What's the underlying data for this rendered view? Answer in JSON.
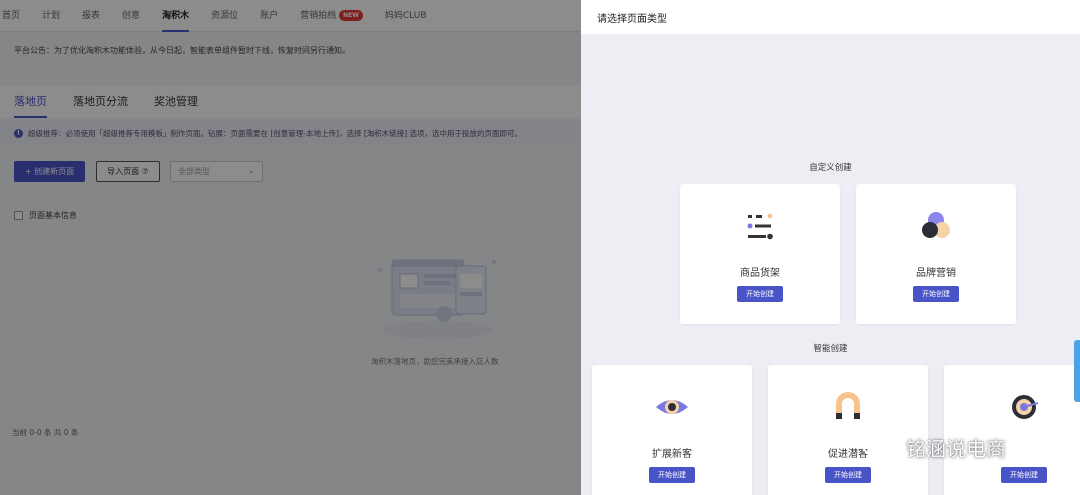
{
  "topnav": {
    "items": [
      "首页",
      "计划",
      "报表",
      "创意",
      "淘积木",
      "资源位",
      "账户",
      "营销拍档",
      "妈妈CLUB"
    ],
    "active_index": 4,
    "new_badge": "NEW"
  },
  "announcement": "平台公告：为了优化淘积木功能体验，从今日起，智能表单组件暂时下线，恢复时间另行通知。",
  "subtabs": {
    "items": [
      "落地页",
      "落地页分流",
      "奖池管理"
    ],
    "active_index": 0
  },
  "tip": "超级推荐：必须使用「超级推荐专用模板」制作页面。钻展：页面需要在 [创意管理-本地上传]，选择 [淘积木链接] 选项，选中用于投放的页面即可。",
  "toolbar": {
    "create_label": "+ 创建新页面",
    "import_label": "导入页面 ⑦",
    "filter_value": "全部类型"
  },
  "table": {
    "header_checkbox_label": "页面基本信息"
  },
  "empty_text": "淘积木落地页，助您完美承接入店人数",
  "pager_text": "当前 0-0 条 共 0 条",
  "drawer": {
    "title": "请选择页面类型",
    "custom_section": "自定义创建",
    "smart_section": "智能创建",
    "custom_cards": [
      {
        "label": "商品货架",
        "button": "开始创建",
        "icon": "shelf-icon"
      },
      {
        "label": "品牌营销",
        "button": "开始创建",
        "icon": "brand-circles-icon"
      }
    ],
    "smart_cards": [
      {
        "label": "扩展新客",
        "button": "开始创建",
        "icon": "eye-icon"
      },
      {
        "label": "促进潜客",
        "button": "开始创建",
        "icon": "magnet-icon"
      },
      {
        "label": "",
        "button": "开始创建",
        "icon": "target-icon"
      }
    ]
  },
  "watermark": "铭涵说电商",
  "colors": {
    "primary": "#4a54c9",
    "new_badge": "#e83b3b",
    "drawer_bg": "#eceef4"
  }
}
